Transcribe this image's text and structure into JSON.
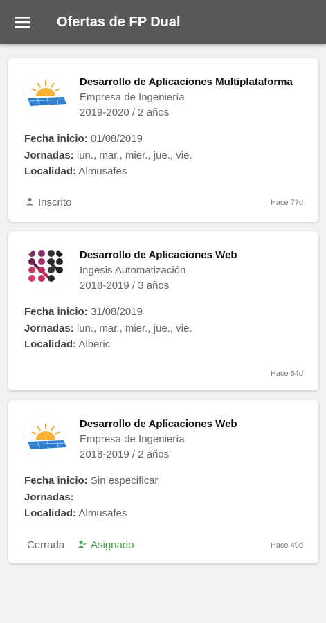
{
  "appbar": {
    "title": "Ofertas de FP Dual",
    "menu_icon": "hamburger-menu-icon"
  },
  "colors": {
    "appbar": "#595959",
    "background": "#f1f1f1",
    "assigned": "#43a047"
  },
  "labels": {
    "fecha_inicio": "Fecha inicio:",
    "jornadas": "Jornadas:",
    "localidad": "Localidad:"
  },
  "offers": [
    {
      "title": "Desarrollo de Aplicaciones Multiplataforma",
      "company": "Empresa de Ingeniería",
      "period": "2019-2020 / 2 años",
      "fecha_inicio": "01/08/2019",
      "jornadas": "lun., mar., mier., jue., vie.",
      "localidad": "Almusafes",
      "status": "Inscrito",
      "status_icon": "person-icon",
      "time": "Hace 77d",
      "logo": "solar-panel-logo"
    },
    {
      "title": "Desarrollo de Aplicaciones Web",
      "company": "Ingesis Automatización",
      "period": "2018-2019 / 3 años",
      "fecha_inicio": "31/08/2019",
      "jornadas": "lun., mar., mier., jue., vie.",
      "localidad": "Alberic",
      "time": "Hace 64d",
      "logo": "dots-network-logo"
    },
    {
      "title": "Desarrollo de Aplicaciones Web",
      "company": "Empresa de Ingeniería",
      "period": "2018-2019 / 2 años",
      "fecha_inicio": "Sin especificar",
      "jornadas": "",
      "localidad": "Almusafes",
      "status_closed": "Cerrada",
      "status": "Asignado",
      "status_icon": "person-check-icon",
      "time": "Hace 49d",
      "logo": "solar-panel-logo"
    }
  ]
}
